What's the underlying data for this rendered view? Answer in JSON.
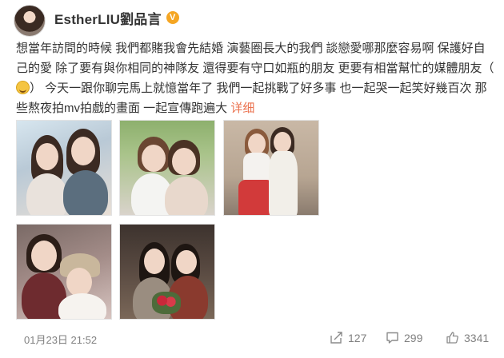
{
  "author": {
    "name": "EstherLIU劉品言",
    "avatar_icon": "user-avatar-icon",
    "verified_icon": "verified-badge-icon",
    "verified_color": "#f5a623"
  },
  "post": {
    "text_1": "想當年訪問的時候 我們都賭我會先結婚 演藝圈長大的我們 談戀愛哪那麼容易啊 保護好自己的愛 除了要有與你相同的神隊友 還得要有守口如瓶的朋友 更要有相當幫忙的媒體朋友（",
    "emoji_icon": "laughing-emoji-icon",
    "text_2": "） 今天一跟你聊完馬上就憶當年了 我們一起挑戰了好多事 也一起哭一起笑好幾百次 那些熬夜拍mv拍戲的畫面 一起宣傳跑遍大",
    "more_label": "详细",
    "more_color": "#eb7350"
  },
  "footer": {
    "timestamp": "01月23日 21:52",
    "share_count": "127",
    "comment_count": "299",
    "like_count": "3341"
  }
}
